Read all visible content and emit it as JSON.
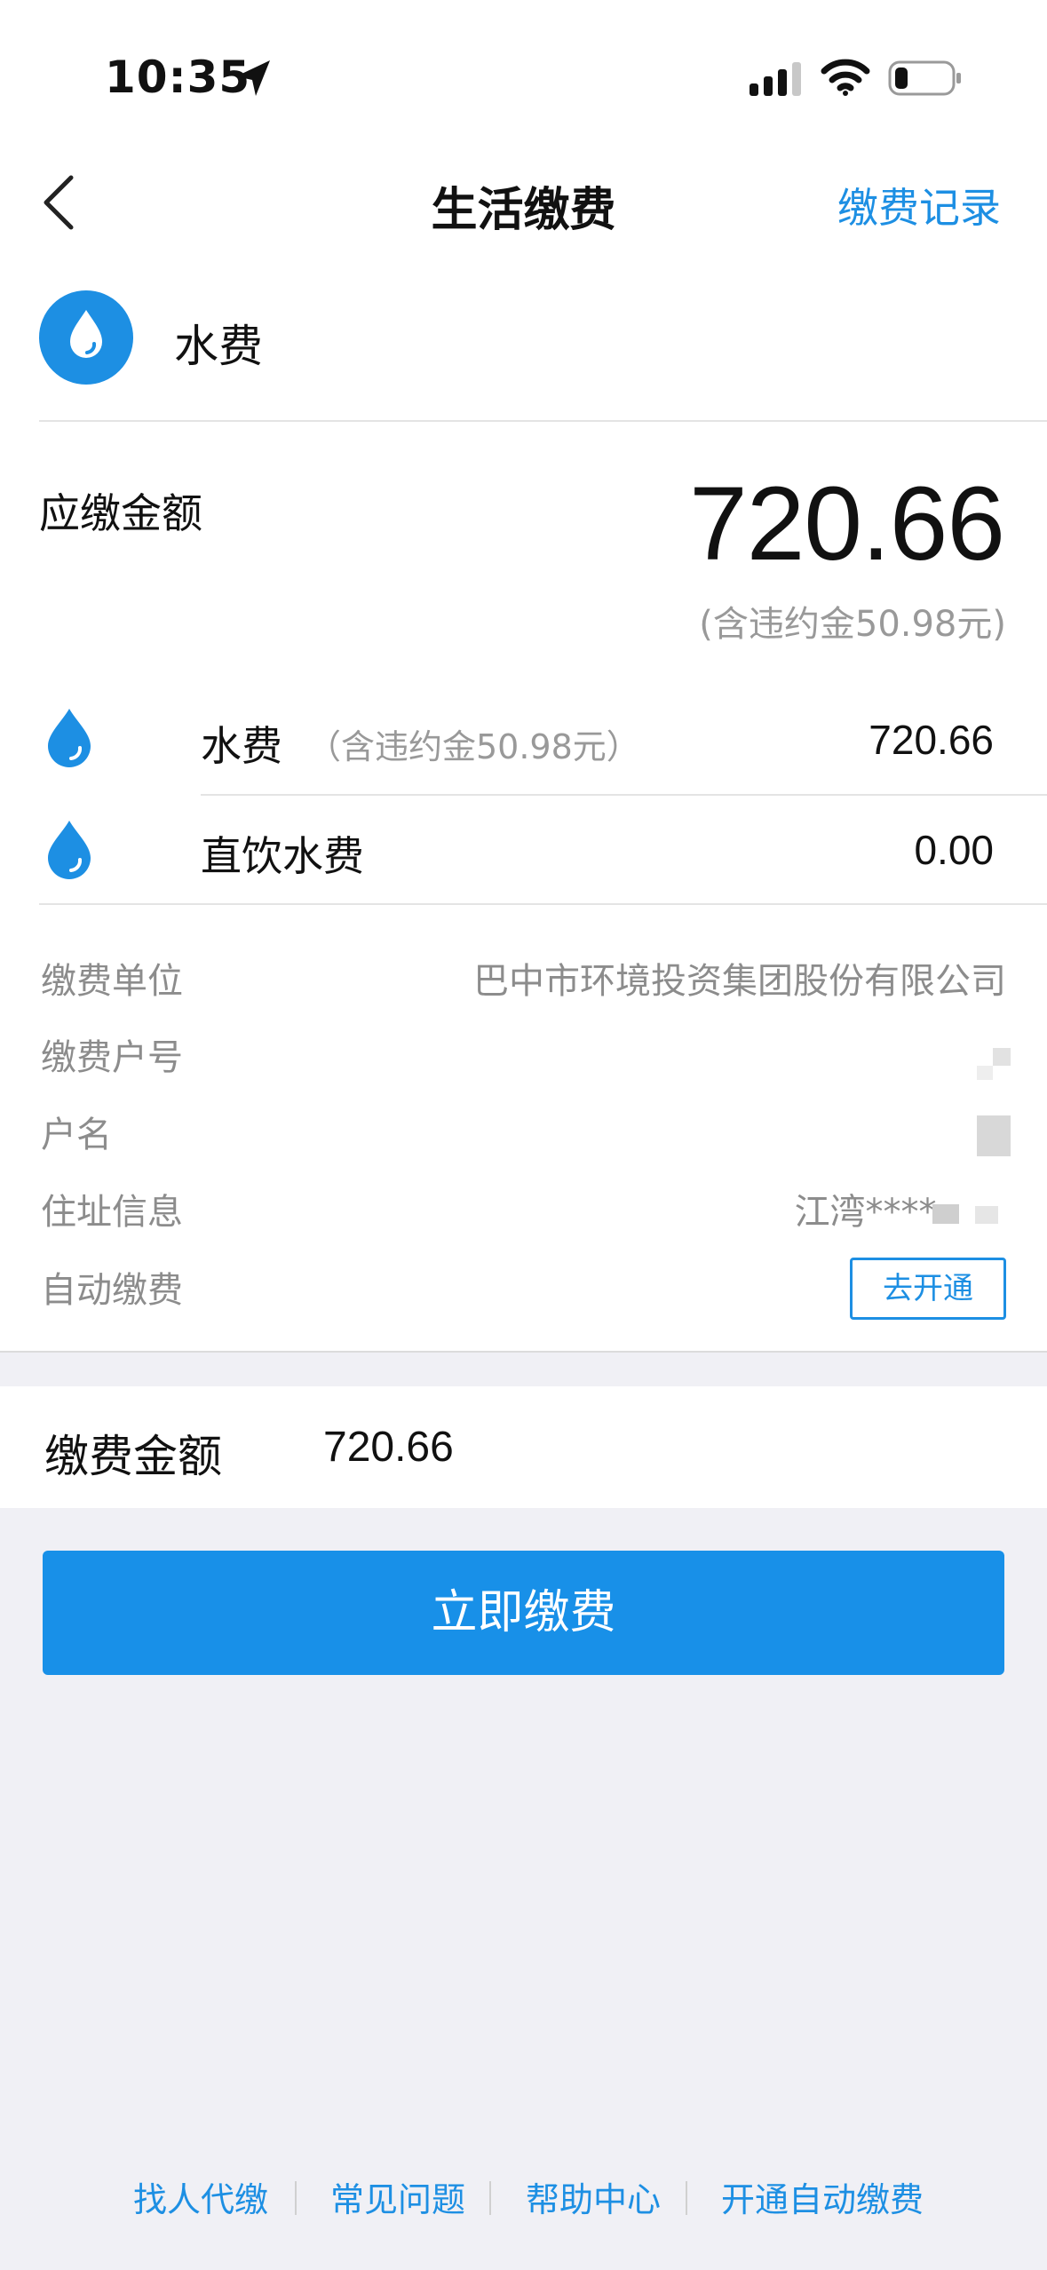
{
  "status_bar": {
    "time": "10:35"
  },
  "nav": {
    "title": "生活缴费",
    "record_link": "缴费记录"
  },
  "bill_type": {
    "label": "水费",
    "icon": "water-drop-icon"
  },
  "amount_due": {
    "label": "应缴金额",
    "amount": "720.66",
    "note": "(含违约金50.98元)"
  },
  "items": [
    {
      "name": "水费",
      "note": "（含违约金50.98元）",
      "value": "720.66",
      "icon": "water-drop-icon"
    },
    {
      "name": "直饮水费",
      "note": "",
      "value": "0.00",
      "icon": "water-drop-icon"
    }
  ],
  "info": {
    "company_label": "缴费单位",
    "company_value": "巴中市环境投资集团股份有限公司",
    "account_label": "缴费户号",
    "name_label": "户名",
    "address_label": "住址信息",
    "address_value": "江湾****-",
    "autopay_label": "自动缴费",
    "autopay_button": "去开通"
  },
  "payment": {
    "label": "缴费金额",
    "value": "720.66",
    "button": "立即缴费"
  },
  "footer": {
    "links": [
      "找人代缴",
      "常见问题",
      "帮助中心",
      "开通自动缴费"
    ]
  },
  "colors": {
    "accent": "#1d8fe3",
    "button": "#1890e8",
    "background": "#f0f0f5"
  }
}
